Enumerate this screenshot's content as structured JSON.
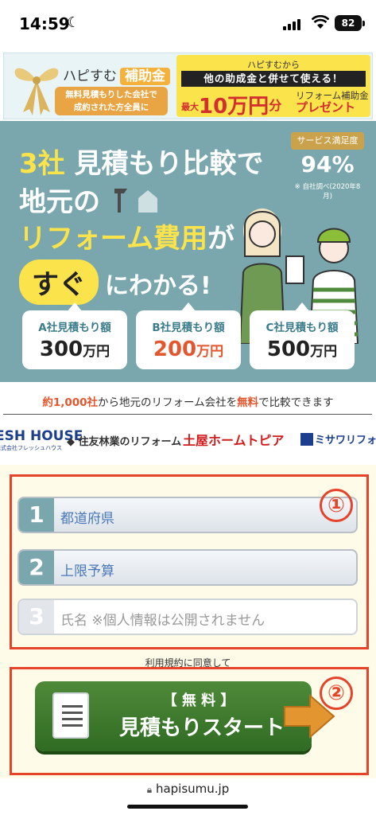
{
  "status": {
    "time": "14:59",
    "battery": "82"
  },
  "banner": {
    "brand": "ハピすむ",
    "subsidy": "補助金",
    "sub_line1": "無料見積もりした会社で",
    "sub_line2": "成約された方全員に",
    "right_top": "ハピすむから",
    "right_bar": "他の助成金と併せて使える！",
    "max_label": "最大",
    "amount": "10万円",
    "amount_suffix": "分",
    "side_line": "リフォーム補助金",
    "present": "プレゼント"
  },
  "hero": {
    "line1_num": "3社",
    "line1_text": "見積もり比較で",
    "line2": "地元の",
    "line3": "リフォーム費用",
    "line3_suffix": "が",
    "line4_pill": "すぐ",
    "line4_text": "にわかる!",
    "badge_title": "サービス満足度",
    "badge_value": "94%",
    "badge_note": "※ 自社調べ(2020年8月)"
  },
  "quotes": [
    {
      "label": "A社見積もり額",
      "value": "300",
      "unit": "万円"
    },
    {
      "label": "B社見積もり額",
      "value": "200",
      "unit": "万円"
    },
    {
      "label": "C社見積もり額",
      "value": "500",
      "unit": "万円"
    }
  ],
  "compare": {
    "prefix": "約1,000社",
    "mid": "から地元のリフォーム会社を",
    "free": "無料",
    "suffix": "で比較できます"
  },
  "logos": {
    "fresh": "ESH HOUSE",
    "fresh_sub": "株式会社フレッシュハウス",
    "sumitomo": "住友林業のリフォーム",
    "tuya": "土屋ホームトピア",
    "misawa": "ミサワリフォー"
  },
  "form": {
    "field1": {
      "num": "1",
      "label": "都道府県"
    },
    "field2": {
      "num": "2",
      "label": "上限予算"
    },
    "field3": {
      "num": "3",
      "placeholder": "氏名 ※個人情報は公開されません"
    },
    "marker1": "①",
    "marker2": "②",
    "terms_link": "利用規約",
    "terms_text": "に同意して",
    "start_small": "【 無 料 】",
    "start_big": "見積もりスタート"
  },
  "urlbar": {
    "url": "hapisumu.jp"
  },
  "colors": {
    "accent_teal": "#7aa7ad",
    "accent_yellow": "#fbe44b",
    "accent_red": "#e5432a",
    "button_green": "#3f7a2e"
  }
}
